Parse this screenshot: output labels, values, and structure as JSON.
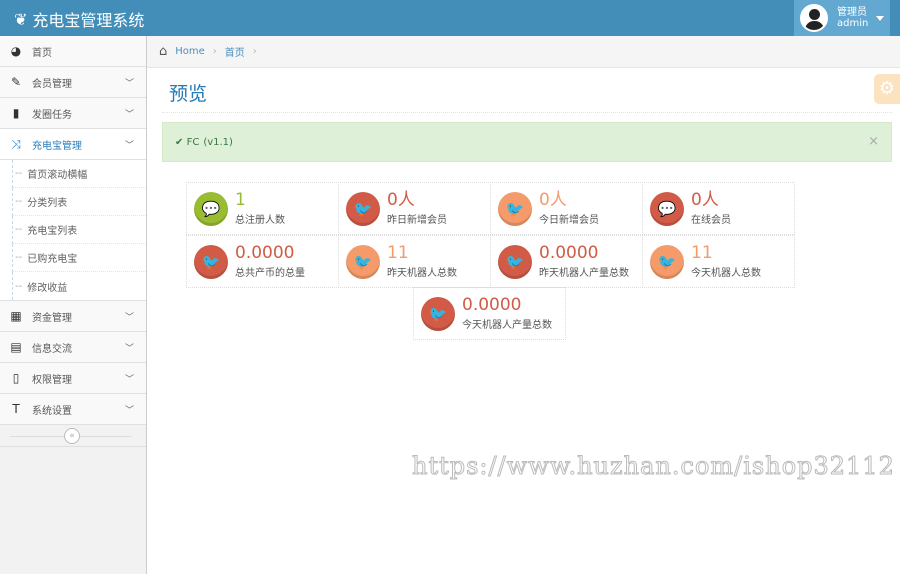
{
  "app": {
    "title": "充电宝管理系统",
    "user_role": "管理员",
    "user_name": "admin"
  },
  "sidebar": {
    "items": [
      {
        "label": "首页",
        "icon": "tachometer-icon"
      },
      {
        "label": "会员管理",
        "icon": "edit-icon"
      },
      {
        "label": "发圈任务",
        "icon": "book-icon"
      },
      {
        "label": "充电宝管理",
        "icon": "random-icon"
      }
    ],
    "submenu": [
      "首页滚动横幅",
      "分类列表",
      "充电宝列表",
      "已购充电宝",
      "修改收益"
    ],
    "items2": [
      {
        "label": "资金管理",
        "icon": "calendar-icon"
      },
      {
        "label": "信息交流",
        "icon": "list-alt-icon"
      },
      {
        "label": "权限管理",
        "icon": "file-icon"
      },
      {
        "label": "系统设置",
        "icon": "text-icon"
      }
    ]
  },
  "breadcrumb": {
    "home": "Home",
    "current": "首页"
  },
  "page": {
    "title": "预览",
    "alert": "FC",
    "version": "(v1.1)"
  },
  "colors": {
    "navbar": "#438eb9",
    "green": "#a0c552",
    "red": "#d9534f",
    "orange": "#f59a6b"
  },
  "stats": [
    {
      "value": "1",
      "label": "总注册人数",
      "color": "#9abc32",
      "icon": "comments-icon"
    },
    {
      "value": "0人",
      "label": "昨日新增会员",
      "color": "#d15b47",
      "icon": "twitter-icon"
    },
    {
      "value": "0人",
      "label": "今日新增会员",
      "color": "#f49a6b",
      "icon": "twitter-icon"
    },
    {
      "value": "0人",
      "label": "在线会员",
      "color": "#d15b47",
      "icon": "comments-icon"
    },
    {
      "value": "0.0000",
      "label": "总共产币的总量",
      "color": "#d15b47",
      "icon": "twitter-icon"
    },
    {
      "value": "11",
      "label": "昨天机器人总数",
      "color": "#f49a6b",
      "icon": "twitter-icon"
    },
    {
      "value": "0.0000",
      "label": "昨天机器人产量总数",
      "color": "#d15b47",
      "icon": "twitter-icon"
    },
    {
      "value": "11",
      "label": "今天机器人总数",
      "color": "#f49a6b",
      "icon": "twitter-icon"
    },
    {
      "value": "0.0000",
      "label": "今天机器人产量总数",
      "color": "#d15b47",
      "icon": "twitter-icon"
    }
  ],
  "watermark": "https://www.huzhan.com/ishop32112"
}
